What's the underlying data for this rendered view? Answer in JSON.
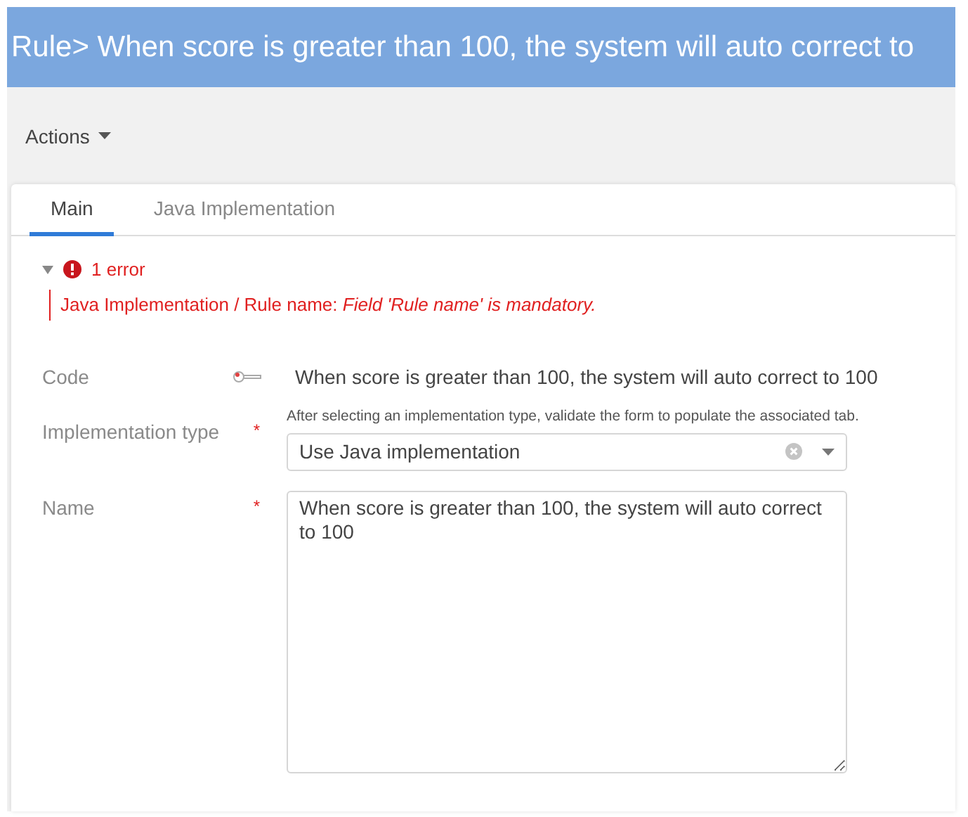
{
  "title": "Rule> When score is greater than 100, the system will auto correct to",
  "actions_menu": {
    "label": "Actions"
  },
  "tabs": [
    {
      "label": "Main",
      "selected": true
    },
    {
      "label": "Java Implementation",
      "selected": false
    }
  ],
  "errors": {
    "expanded": true,
    "count_label": "1 error",
    "messages": [
      {
        "path": "Java Implementation / Rule name: ",
        "detail": "Field 'Rule name' is mandatory."
      }
    ]
  },
  "fields": [
    {
      "kind": "readonly",
      "label": "Code",
      "value": "When score is greater than 100, the system will auto correct to 100"
    },
    {
      "kind": "select",
      "label": "Implementation type",
      "required_mark": "*",
      "help": "After selecting an implementation type, validate the form to populate the associated tab.",
      "value": "Use Java implementation"
    },
    {
      "kind": "textarea",
      "label": "Name",
      "required_mark": "*",
      "value": "When score is greater than 100, the system will auto correct to 100"
    }
  ]
}
